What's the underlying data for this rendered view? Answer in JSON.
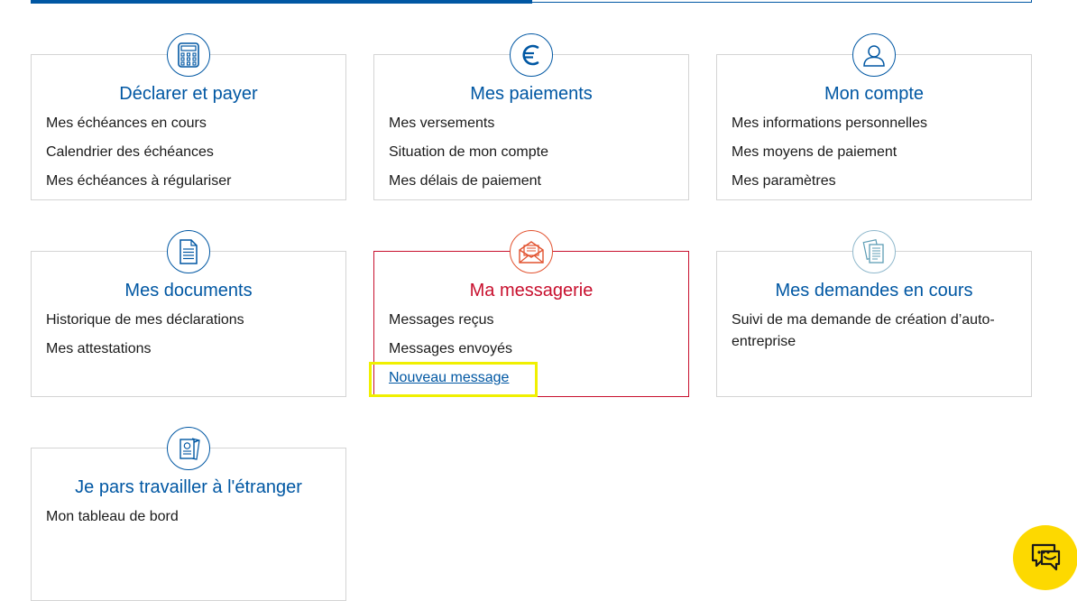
{
  "colors": {
    "primary": "#0057a3",
    "accent": "#c8102e",
    "highlight": "#f0f000",
    "chat": "#fdd900"
  },
  "cards": [
    {
      "icon": "calculator-icon",
      "title": "Déclarer et payer",
      "items": [
        "Mes échéances en cours",
        "Calendrier des échéances",
        "Mes échéances à régulariser"
      ]
    },
    {
      "icon": "euro-icon",
      "title": "Mes paiements",
      "items": [
        "Mes versements",
        "Situation de mon compte",
        "Mes délais de paiement"
      ]
    },
    {
      "icon": "user-icon",
      "title": "Mon compte",
      "items": [
        "Mes informations personnelles",
        "Mes moyens de paiement",
        "Mes paramètres"
      ]
    },
    {
      "icon": "document-icon",
      "title": "Mes documents",
      "items": [
        "Historique de mes déclarations",
        "Mes attestations"
      ]
    },
    {
      "icon": "envelope-icon",
      "title": "Ma messagerie",
      "active": true,
      "items": [
        "Messages reçus",
        "Messages envoyés",
        "Nouveau message"
      ]
    },
    {
      "icon": "papers-icon",
      "title": "Mes demandes en cours",
      "items": [
        "Suivi de ma demande de création d’auto-entreprise"
      ]
    },
    {
      "icon": "passport-icon",
      "title": "Je pars travailler à l'étranger",
      "items": [
        "Mon tableau de bord"
      ]
    }
  ],
  "chat_button": {
    "icon": "chat-icon"
  }
}
